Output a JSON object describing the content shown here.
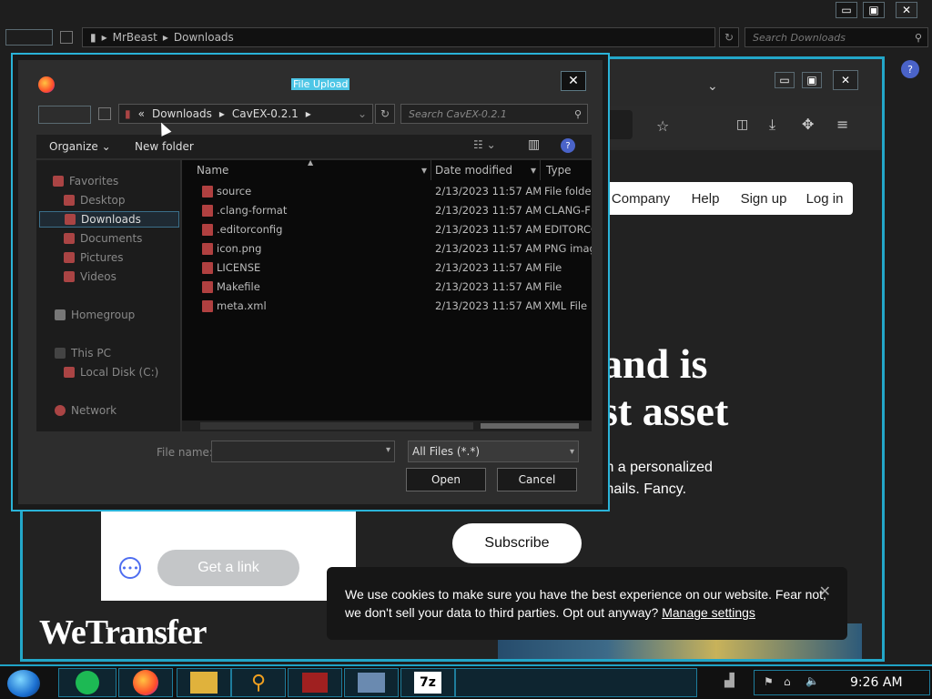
{
  "explorer": {
    "breadcrumb": [
      "MrBeast",
      "Downloads"
    ],
    "search_placeholder": "Search Downloads"
  },
  "browser": {
    "nav": [
      "Company",
      "Help",
      "Sign up",
      "Log in"
    ],
    "headline_lines": [
      "and is",
      "st asset"
    ],
    "sub_lines": [
      "th a personalized",
      "mails. Fancy."
    ],
    "subscribe_label": "Subscribe",
    "get_link_label": "Get a link",
    "logo": "WeTransfer",
    "cookie": {
      "text": "We use cookies to make sure you have the best experience on our website. Fear not, we don't sell your data to third parties. Opt out anyway?",
      "link": "Manage settings",
      "close": "✕"
    }
  },
  "dialog": {
    "title": "File Upload",
    "address": {
      "prefix": "«",
      "crumbs": [
        "Downloads",
        "CavEX-0.2.1"
      ]
    },
    "search_placeholder": "Search CavEX-0.2.1",
    "toolbar": {
      "organize": "Organize",
      "new_folder": "New folder"
    },
    "nav": {
      "favorites": "Favorites",
      "desktop": "Desktop",
      "downloads": "Downloads",
      "documents": "Documents",
      "pictures": "Pictures",
      "videos": "Videos",
      "homegroup": "Homegroup",
      "this_pc": "This PC",
      "local_disk": "Local Disk (C:)",
      "network": "Network"
    },
    "columns": {
      "name": "Name",
      "date": "Date modified",
      "type": "Type"
    },
    "files": [
      {
        "name": "source",
        "date": "2/13/2023 11:57 AM",
        "type": "File folder"
      },
      {
        "name": ".clang-format",
        "date": "2/13/2023 11:57 AM",
        "type": "CLANG-F"
      },
      {
        "name": ".editorconfig",
        "date": "2/13/2023 11:57 AM",
        "type": "EDITORCO"
      },
      {
        "name": "icon.png",
        "date": "2/13/2023 11:57 AM",
        "type": "PNG imag"
      },
      {
        "name": "LICENSE",
        "date": "2/13/2023 11:57 AM",
        "type": "File"
      },
      {
        "name": "Makefile",
        "date": "2/13/2023 11:57 AM",
        "type": "File"
      },
      {
        "name": "meta.xml",
        "date": "2/13/2023 11:57 AM",
        "type": "XML File"
      }
    ],
    "file_name_label": "File name:",
    "file_name_value": "",
    "filter": "All Files (*.*)",
    "open_label": "Open",
    "cancel_label": "Cancel"
  },
  "taskbar": {
    "clock": "9:26 AM",
    "apps": [
      "spotify-icon",
      "firefox-icon",
      "explorer-icon",
      "search-icon",
      "game-icon",
      "computer-icon",
      "7zip-icon"
    ],
    "sevenzip_label": "7z"
  },
  "colors": {
    "accent": "#23a7c9",
    "dialog_bg": "#2d2d2d",
    "file_pane_bg": "#0a0a0a"
  }
}
